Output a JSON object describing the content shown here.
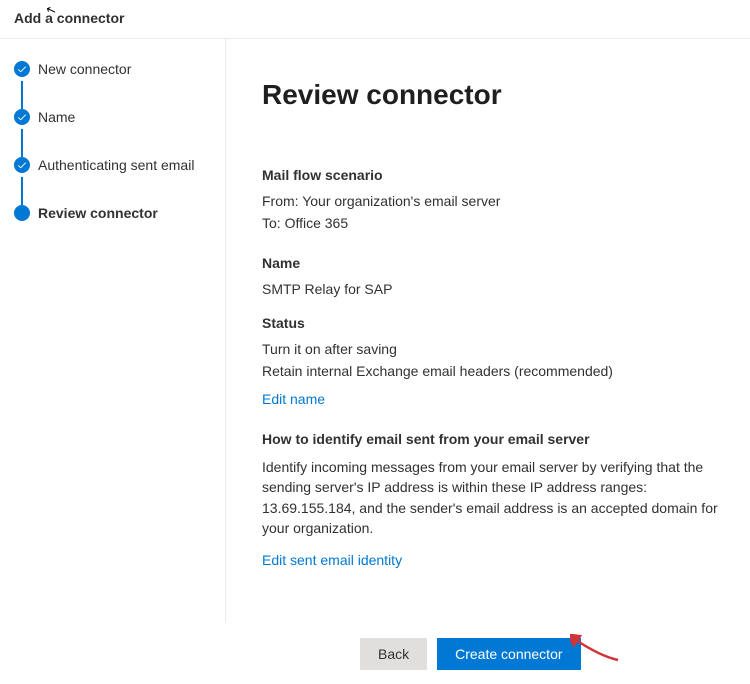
{
  "header": {
    "title": "Add a connector"
  },
  "steps": [
    {
      "label": "New connector",
      "done": true
    },
    {
      "label": "Name",
      "done": true
    },
    {
      "label": "Authenticating sent email",
      "done": true
    },
    {
      "label": "Review connector",
      "current": true
    }
  ],
  "page": {
    "title": "Review connector",
    "mailFlow": {
      "heading": "Mail flow scenario",
      "from": "From: Your organization's email server",
      "to": "To: Office 365"
    },
    "name": {
      "heading": "Name",
      "value": "SMTP Relay for SAP"
    },
    "status": {
      "heading": "Status",
      "line1": "Turn it on after saving",
      "line2": "Retain internal Exchange email headers (recommended)",
      "editLink": "Edit name"
    },
    "identify": {
      "heading": "How to identify email sent from your email server",
      "body": "Identify incoming messages from your email server by verifying that the sending server's IP address is within these IP address ranges: 13.69.155.184, and the sender's email address is an accepted domain for your organization.",
      "editLink": "Edit sent email identity"
    }
  },
  "footer": {
    "back": "Back",
    "create": "Create connector"
  }
}
